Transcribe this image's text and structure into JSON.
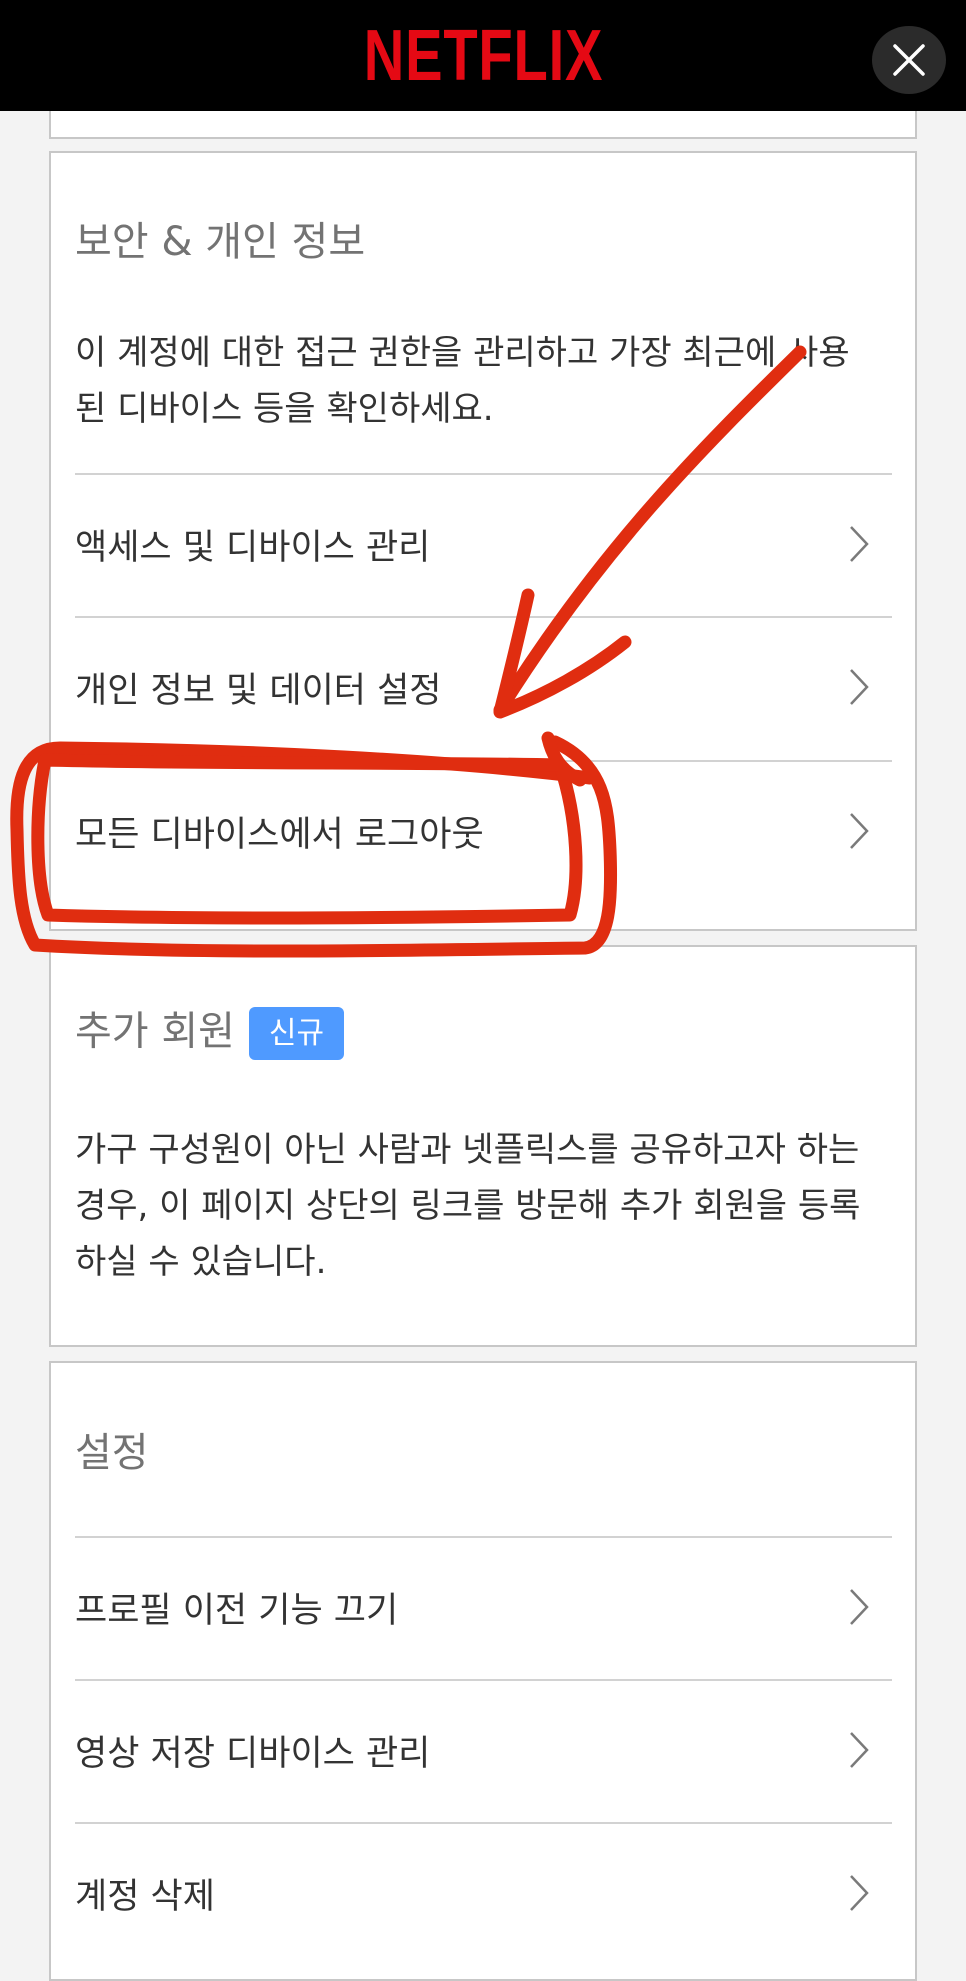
{
  "header": {
    "logo_text": "NETFLIX",
    "brand_color": "#e50914",
    "close_icon": "close-icon"
  },
  "security": {
    "title": "보안 & 개인 정보",
    "description": "이 계정에 대한 접근 권한을 관리하고 가장 최근에 사용된 디바이스 등을 확인하세요.",
    "items": [
      {
        "label": "액세스 및 디바이스 관리",
        "icon": "chevron-right-icon"
      },
      {
        "label": "개인 정보 및 데이터 설정",
        "icon": "chevron-right-icon"
      },
      {
        "label": "모든 디바이스에서 로그아웃",
        "icon": "chevron-right-icon"
      }
    ]
  },
  "extra_members": {
    "title": "추가 회원",
    "badge": "신규",
    "badge_color": "#4f9aff",
    "description": "가구 구성원이 아닌 사람과 넷플릭스를 공유하고자 하는 경우, 이 페이지 상단의 링크를 방문해 추가 회원을 등록하실 수 있습니다."
  },
  "settings": {
    "title": "설정",
    "items": [
      {
        "label": "프로필 이전 기능 끄기",
        "icon": "chevron-right-icon"
      },
      {
        "label": "영상 저장 디바이스 관리",
        "icon": "chevron-right-icon"
      },
      {
        "label": "계정 삭제",
        "icon": "chevron-right-icon"
      }
    ]
  },
  "annotation": {
    "color": "#e02d10",
    "shapes": [
      "hand-drawn-arrow",
      "hand-drawn-box-highlight"
    ]
  }
}
